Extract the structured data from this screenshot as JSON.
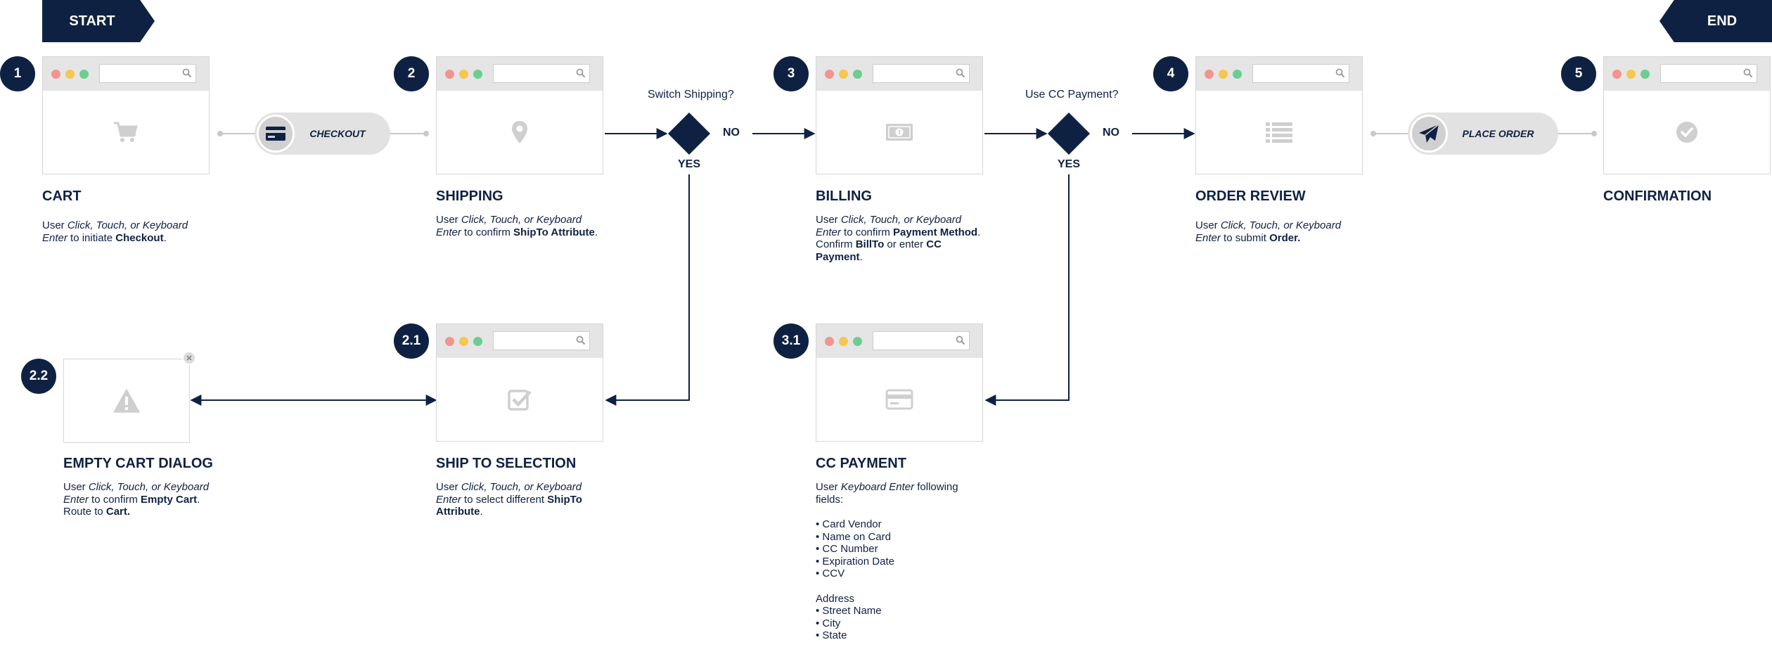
{
  "flags": {
    "start": "START",
    "end": "END"
  },
  "steps": [
    {
      "num": "1",
      "title": "CART",
      "icon": "cart-icon"
    },
    {
      "num": "2",
      "title": "SHIPPING",
      "icon": "location-pin-icon"
    },
    {
      "num": "3",
      "title": "BILLING",
      "icon": "money-icon"
    },
    {
      "num": "4",
      "title": "ORDER REVIEW",
      "icon": "list-icon"
    },
    {
      "num": "5",
      "title": "CONFIRMATION",
      "icon": "check-circle-icon"
    },
    {
      "num": "2.1",
      "title": "SHIP TO SELECTION",
      "icon": "checkbox-icon"
    },
    {
      "num": "3.1",
      "title": "CC PAYMENT",
      "icon": "credit-card-icon"
    },
    {
      "num": "2.2",
      "title": "EMPTY CART DIALOG",
      "icon": "warning-icon"
    }
  ],
  "actions": {
    "checkout": "CHECKOUT",
    "place_order": "PLACE ORDER"
  },
  "decisions": {
    "switch_shipping": {
      "question": "Switch Shipping?",
      "no": "NO",
      "yes": "YES"
    },
    "use_cc": {
      "question": "Use CC Payment?",
      "no": "NO",
      "yes": "YES"
    }
  },
  "descriptions": {
    "cart": [
      "User ",
      "Click, Touch, or Keyboard Enter",
      " to initiate ",
      "Checkout",
      "."
    ],
    "shipping": [
      "User ",
      "Click, Touch, or Keyboard Enter",
      " to confirm ",
      "ShipTo Attribute",
      "."
    ],
    "billing": [
      "User ",
      "Click, Touch, or Keyboard Enter",
      " to confirm ",
      "Payment Method",
      ". Confirm ",
      "BillTo",
      " or enter ",
      "CC Payment",
      "."
    ],
    "order_review": [
      "User ",
      "Click, Touch, or Keyboard Enter",
      " to submit ",
      "Order."
    ],
    "ship_to_selection": [
      "User ",
      "Click, Touch, or Keyboard Enter",
      " to select different ",
      "ShipTo Attribute",
      "."
    ],
    "empty_cart": [
      "User ",
      "Click, Touch, or Keyboard Enter",
      " to confirm ",
      "Empty Cart",
      ".",
      "Route to ",
      "Cart."
    ],
    "cc_payment": {
      "intro": [
        "User ",
        "Keyboard Enter",
        " following fields:"
      ],
      "fields": [
        "• Card Vendor",
        "• Name on Card",
        "• CC Number",
        "• Expiration Date",
        "• CCV"
      ],
      "address_heading": "Address",
      "address_fields": [
        "• Street Name",
        "• City",
        "• State"
      ]
    }
  },
  "colors": {
    "navy": "#0f2143",
    "icon_gray": "#cfcfcf",
    "frame_gray": "#e5e5e5"
  }
}
